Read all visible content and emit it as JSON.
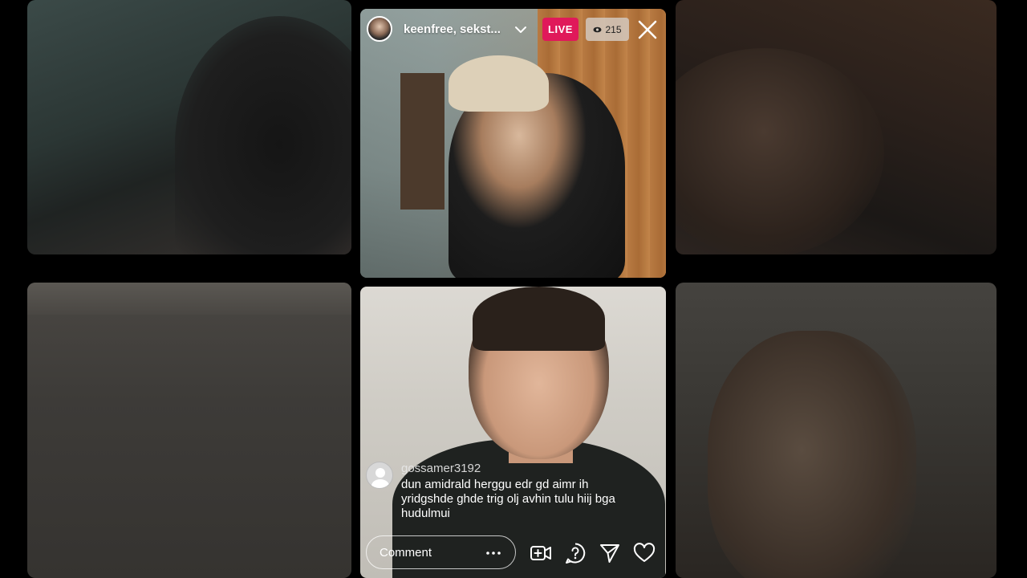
{
  "header": {
    "host_name": "keenfree, sekst...",
    "live_label": "LIVE",
    "viewer_count": "215"
  },
  "comment": {
    "username": "gossamer3192",
    "text": "dun amidrald herggu edr gd aimr ih yridgshde ghde trig olj avhin tulu hiij bga hudulmui"
  },
  "bottom_bar": {
    "comment_placeholder": "Comment",
    "icons": [
      "more-icon",
      "add-video-icon",
      "question-icon",
      "share-icon",
      "heart-icon"
    ]
  },
  "colors": {
    "live_badge": "#e0195a",
    "viewer_badge": "#d2c8be"
  }
}
